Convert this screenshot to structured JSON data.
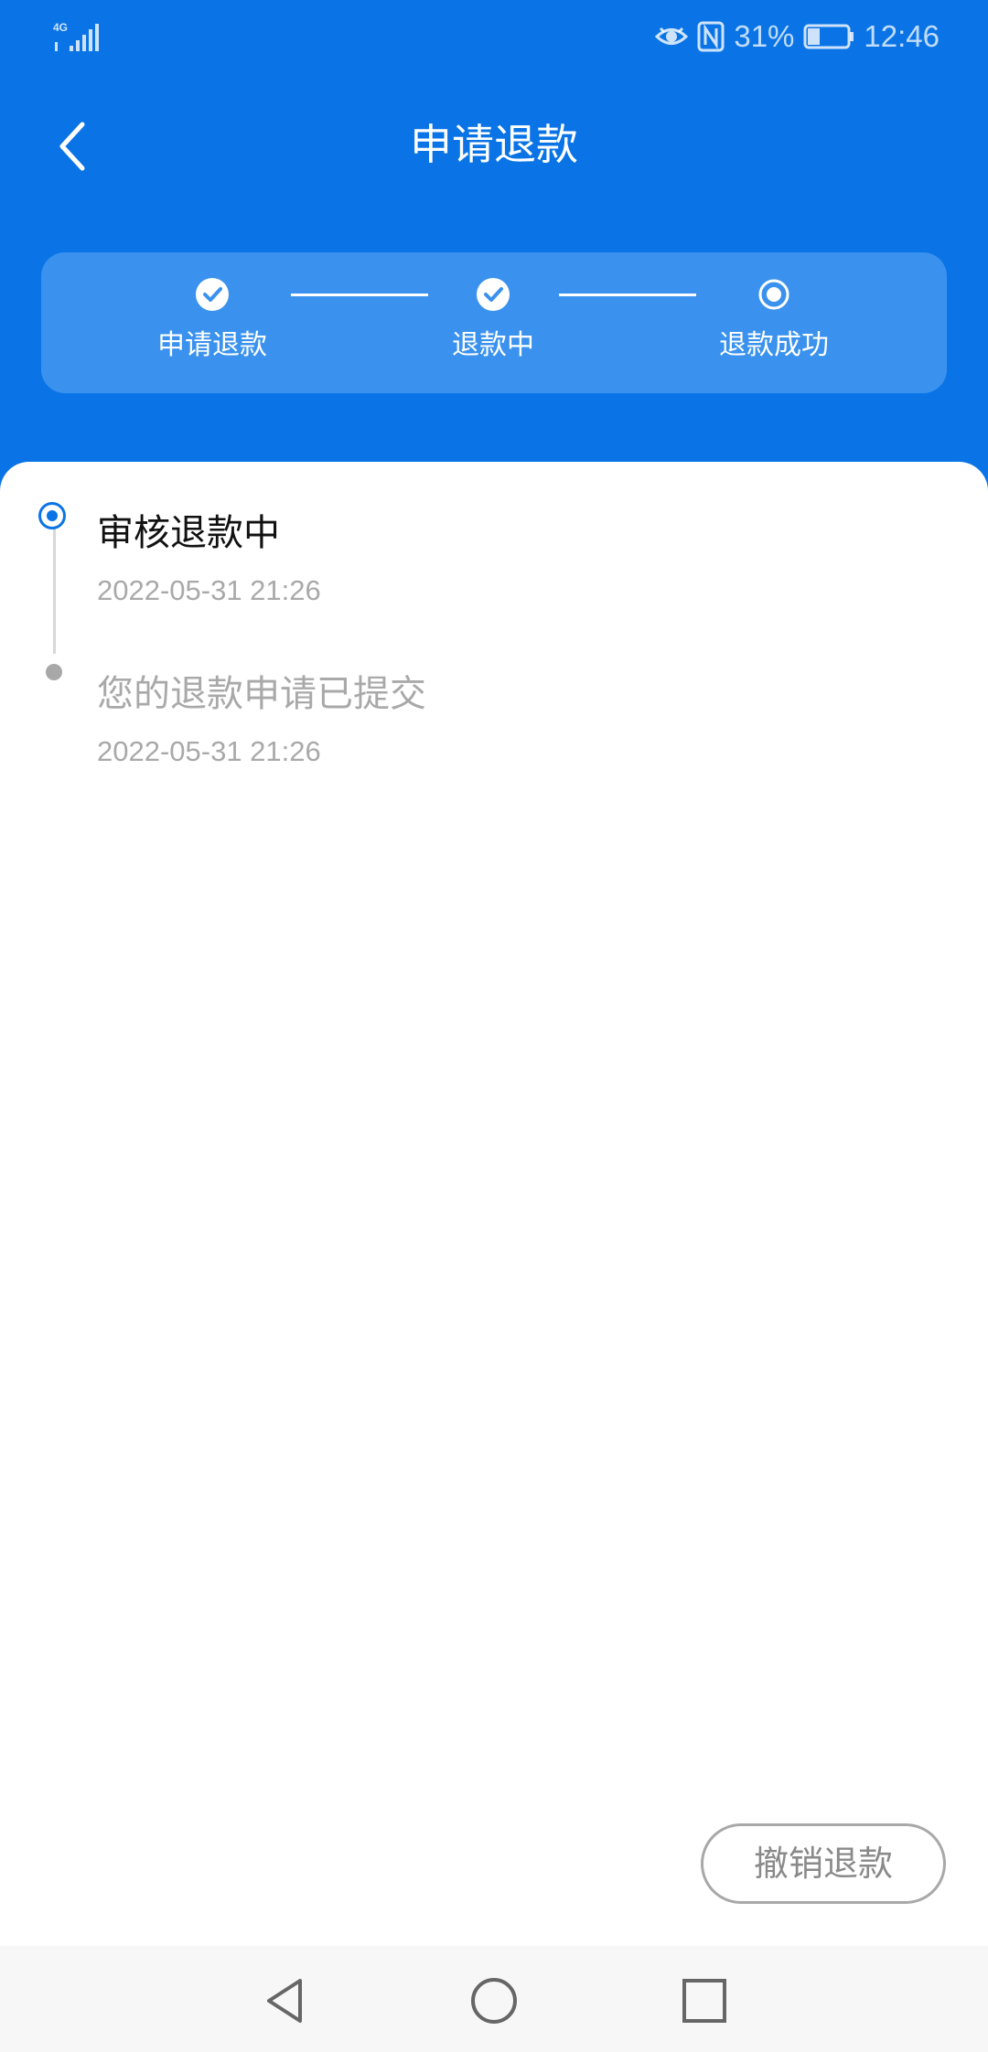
{
  "status_bar": {
    "network": "4G",
    "battery_percent": "31%",
    "battery_level": 0.31,
    "time": "12:46"
  },
  "nav": {
    "title": "申请退款"
  },
  "steps": [
    {
      "label": "申请退款",
      "state": "done"
    },
    {
      "label": "退款中",
      "state": "done"
    },
    {
      "label": "退款成功",
      "state": "current"
    }
  ],
  "timeline": [
    {
      "title": "审核退款中",
      "time": "2022-05-31 21:26",
      "active": true
    },
    {
      "title": "您的退款申请已提交",
      "time": "2022-05-31 21:26",
      "active": false
    }
  ],
  "actions": {
    "cancel_refund": "撤销退款"
  },
  "colors": {
    "primary": "#0a74e6",
    "panel": "#3a92ee",
    "muted": "#a9a9a9"
  },
  "icons": {
    "back": "chevron-left-icon",
    "step_done": "check-circle-icon",
    "step_current": "radio-circle-icon",
    "sys_back": "triangle-back-icon",
    "sys_home": "circle-home-icon",
    "sys_recent": "square-recent-icon"
  }
}
